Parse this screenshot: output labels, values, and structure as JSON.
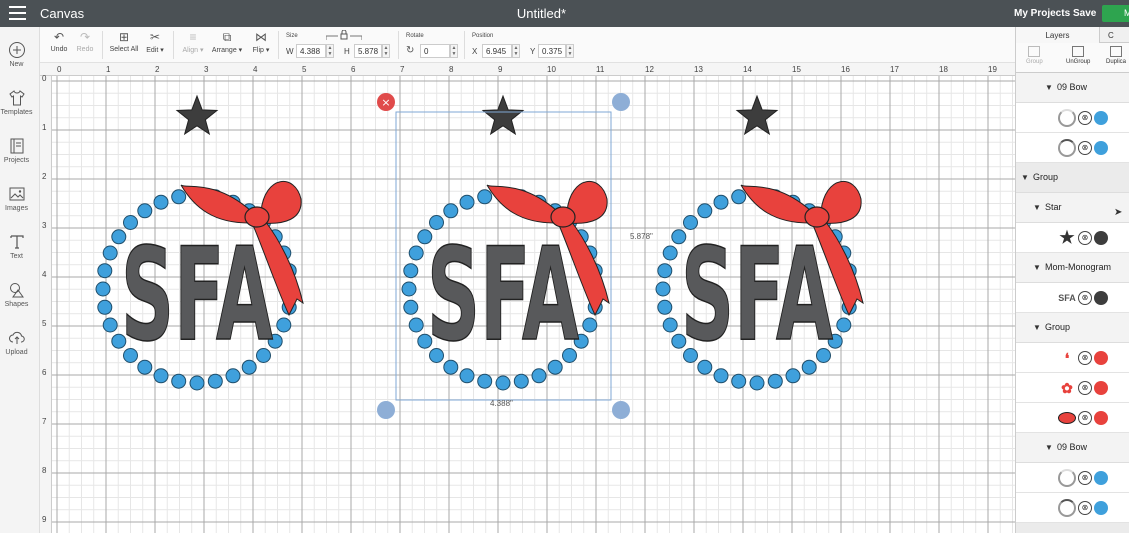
{
  "topbar": {
    "app_title": "Canvas",
    "doc_title": "Untitled*",
    "my_projects": "My Projects",
    "save": "Save",
    "make": "M"
  },
  "leftbar": [
    {
      "label": "New",
      "icon": "plus-circle-icon"
    },
    {
      "label": "Templates",
      "icon": "tshirt-icon"
    },
    {
      "label": "Projects",
      "icon": "book-icon"
    },
    {
      "label": "Images",
      "icon": "image-icon"
    },
    {
      "label": "Text",
      "icon": "text-t-icon"
    },
    {
      "label": "Shapes",
      "icon": "shapes-icon"
    },
    {
      "label": "Upload",
      "icon": "cloud-upload-icon"
    }
  ],
  "toolbar": {
    "undo": "Undo",
    "redo": "Redo",
    "select_all": "Select All",
    "edit": "Edit ▾",
    "align": "Align ▾",
    "arrange": "Arrange ▾",
    "flip": "Flip ▾",
    "size_label": "Size",
    "w_label": "W",
    "w_value": "4.388",
    "h_label": "H",
    "h_value": "5.878",
    "rotate_label": "Rotate",
    "rotate_value": "0",
    "position_label": "Position",
    "x_label": "X",
    "x_value": "6.945",
    "y_label": "Y",
    "y_value": "0.375"
  },
  "rulers": {
    "h": [
      "0",
      "1",
      "2",
      "3",
      "4",
      "5",
      "6",
      "7",
      "8",
      "9",
      "10",
      "11",
      "12",
      "13",
      "14",
      "15",
      "16",
      "17",
      "18",
      "19"
    ],
    "v": [
      "0",
      "1",
      "2",
      "3",
      "4",
      "5",
      "6",
      "7",
      "8",
      "9"
    ]
  },
  "canvas": {
    "monogram_text": "SFA",
    "selection_height": "5.878\"",
    "selection_width": "4.388\"",
    "colors": {
      "star": "#3d3d3d",
      "monogram": "#58595b",
      "bow": "#e8423d",
      "dots": "#3fa0dc"
    }
  },
  "layers_panel": {
    "tab_layers": "Layers",
    "tab_color": "C",
    "tools": [
      "Group",
      "UnGroup",
      "Duplica"
    ],
    "rows": [
      {
        "kind": "header",
        "label": "09 Bow",
        "level": 2
      },
      {
        "kind": "layer",
        "thumb": "ring",
        "color": "#3fa0dc"
      },
      {
        "kind": "layer",
        "thumb": "ring2",
        "color": "#3fa0dc"
      },
      {
        "kind": "header",
        "label": "Group",
        "level": 0
      },
      {
        "kind": "header",
        "label": "Star",
        "level": 1
      },
      {
        "kind": "layer",
        "thumb": "star",
        "color": "#3d3d3d"
      },
      {
        "kind": "header",
        "label": "Mom-Monogram",
        "level": 1
      },
      {
        "kind": "layer",
        "thumb": "monogram",
        "thumb_text": "SFA",
        "color": "#3d3d3d"
      },
      {
        "kind": "header",
        "label": "Group",
        "level": 1
      },
      {
        "kind": "layer",
        "thumb": "bow-tails",
        "color": "#e8423d"
      },
      {
        "kind": "layer",
        "thumb": "bow",
        "color": "#e8423d"
      },
      {
        "kind": "layer",
        "thumb": "oval",
        "color": "#e8423d"
      },
      {
        "kind": "header",
        "label": "09 Bow",
        "level": 2
      },
      {
        "kind": "layer",
        "thumb": "ring",
        "color": "#3fa0dc"
      },
      {
        "kind": "layer",
        "thumb": "ring2",
        "color": "#3fa0dc"
      },
      {
        "kind": "header",
        "label": "Group",
        "level": 0
      }
    ]
  }
}
